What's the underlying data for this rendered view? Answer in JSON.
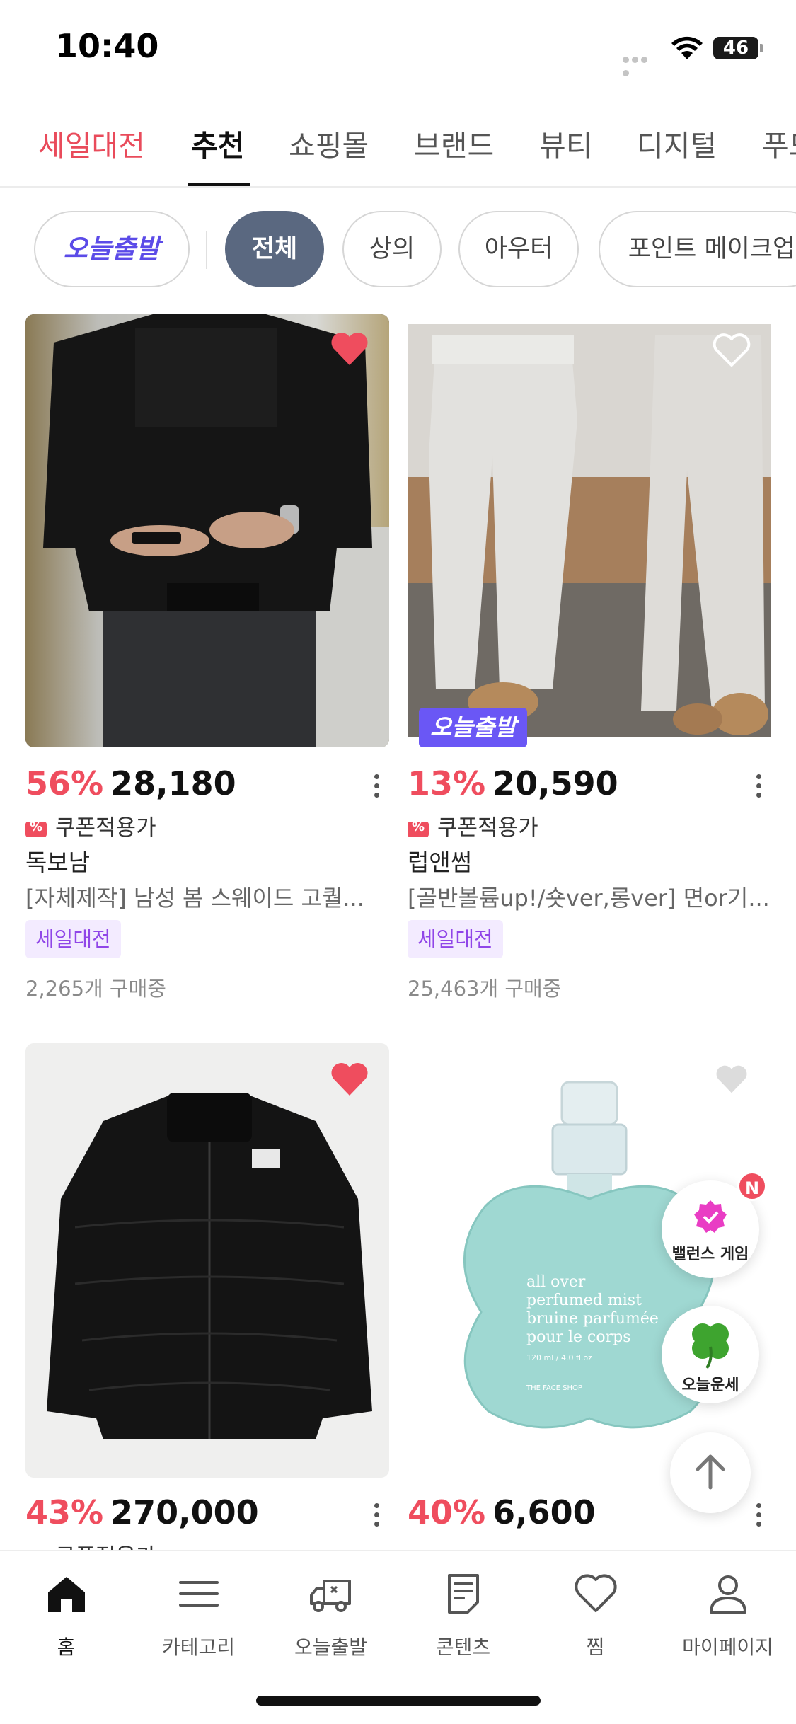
{
  "status_bar": {
    "time": "10:40",
    "battery": "46"
  },
  "top_tabs": [
    {
      "label": "세일대전"
    },
    {
      "label": "추천"
    },
    {
      "label": "쇼핑몰"
    },
    {
      "label": "브랜드"
    },
    {
      "label": "뷰티"
    },
    {
      "label": "디지털"
    },
    {
      "label": "푸드"
    }
  ],
  "chips": [
    {
      "label": "오늘출발"
    },
    {
      "label": "전체"
    },
    {
      "label": "상의"
    },
    {
      "label": "아우터"
    },
    {
      "label": "포인트 메이크업"
    }
  ],
  "products": [
    {
      "discount": "56%",
      "price": "28,180",
      "coupon": "쿠폰적용가",
      "brand": "독보남",
      "title": "[자체제작] 남성 봄 스웨이드 고퀄...",
      "tag": "세일대전",
      "buying": "2,265개 구매중",
      "liked": true
    },
    {
      "discount": "13%",
      "price": "20,590",
      "coupon": "쿠폰적용가",
      "brand": "럽앤썸",
      "title": "[골반볼륨up!/숏ver,롱ver] 면or기...",
      "tag": "세일대전",
      "buying": "25,463개 구매중",
      "liked": false,
      "badge": "오늘출발"
    },
    {
      "discount": "43%",
      "price": "270,000",
      "coupon": "쿠폰적용가",
      "liked": true
    },
    {
      "discount": "40%",
      "price": "6,600",
      "liked": false,
      "image_text": [
        "all over",
        "perfumed mist",
        "bruine parfumée",
        "pour le corps",
        "120 ml / 4.0 fl.oz",
        "THE FACE SHOP"
      ]
    }
  ],
  "floating": {
    "balance_game": "밸런스 게임",
    "fortune": "오늘운세",
    "new_badge": "N"
  },
  "bottom_nav": [
    {
      "label": "홈",
      "icon": "home-icon"
    },
    {
      "label": "카테고리",
      "icon": "menu-icon"
    },
    {
      "label": "오늘출발",
      "icon": "truck-icon"
    },
    {
      "label": "콘텐츠",
      "icon": "document-icon"
    },
    {
      "label": "찜",
      "icon": "heart-icon"
    },
    {
      "label": "마이페이지",
      "icon": "user-icon"
    }
  ],
  "colors": {
    "accent_red": "#ef4d5e",
    "sale_tab": "#e94b5b",
    "today_purple": "#6a57f5",
    "tag_purple": "#9046e8",
    "active_chip": "#5a6880"
  }
}
